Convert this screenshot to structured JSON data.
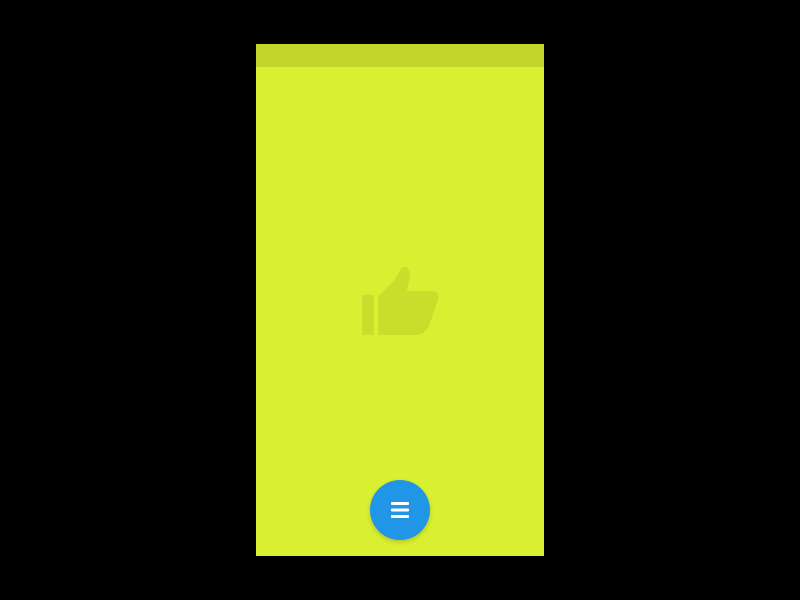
{
  "colors": {
    "outer_background": "#000000",
    "screen_background": "#d8ef32",
    "status_bar": "#c3d42b",
    "thumb_icon": "#c9de2c",
    "fab_background": "#2196e6",
    "fab_icon": "#ffffff"
  },
  "icons": {
    "center": "thumbs-up-icon",
    "fab": "menu-icon"
  }
}
